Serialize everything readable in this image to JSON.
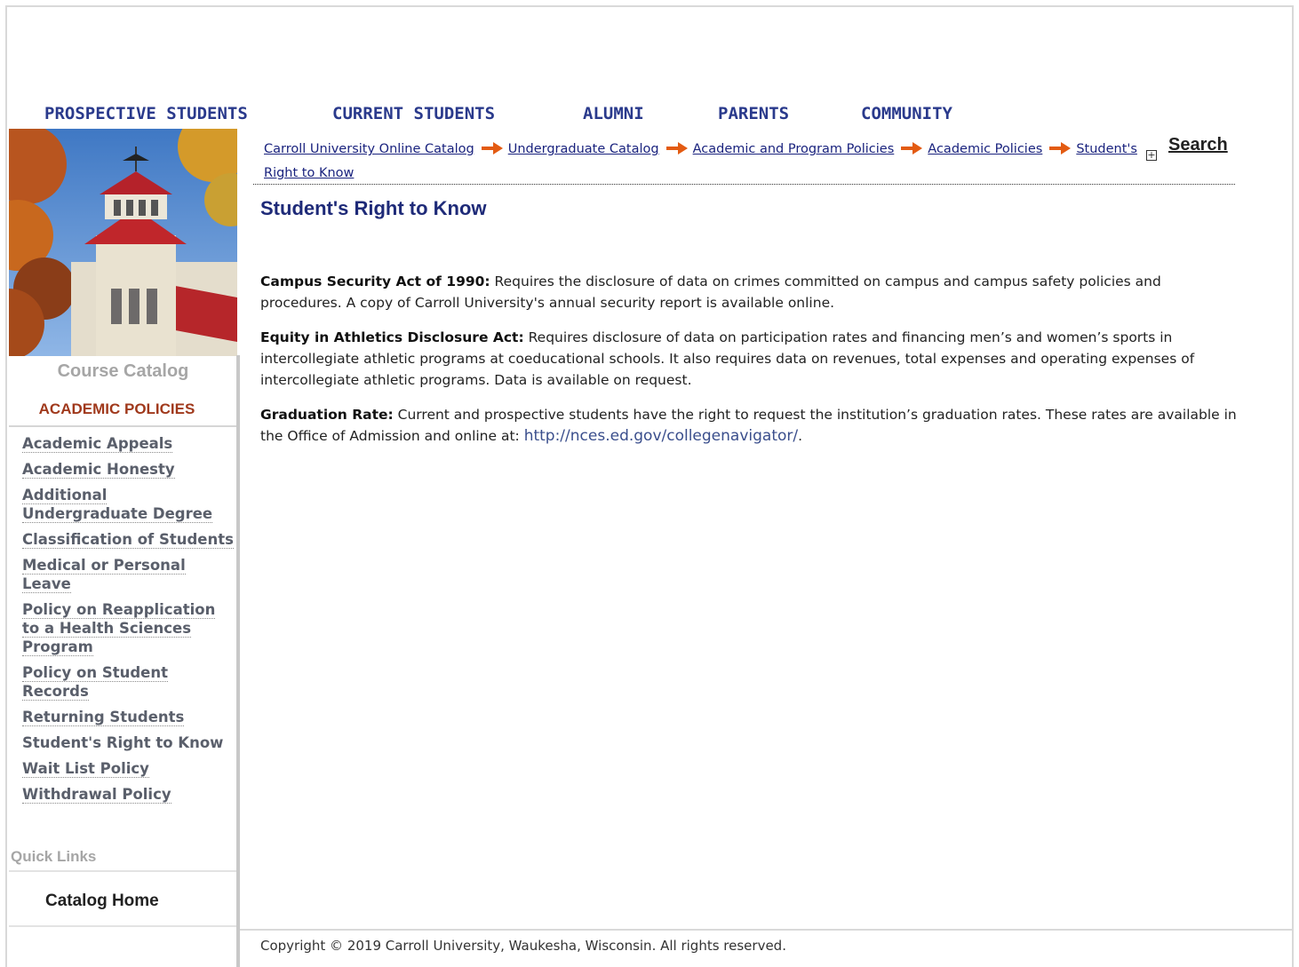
{
  "topnav": {
    "items": [
      "PROSPECTIVE STUDENTS",
      "CURRENT STUDENTS",
      "ALUMNI",
      "PARENTS",
      "COMMUNITY"
    ]
  },
  "sidebar": {
    "catalog_label": "Course Catalog",
    "heading": "ACADEMIC POLICIES",
    "links": [
      "Academic Appeals",
      "Academic Honesty",
      "Additional Undergraduate Degree",
      "Classification of Students",
      "Medical or Personal Leave",
      "Policy on Reapplication to a Health Sciences Program",
      "Policy on Student Records",
      "Returning Students",
      "Student's Right to Know",
      "Wait List Policy",
      "Withdrawal Policy"
    ],
    "quick_links_label": "Quick Links",
    "catalog_home": "Catalog Home"
  },
  "breadcrumb": [
    "Carroll University Online Catalog",
    "Undergraduate Catalog",
    "Academic and Program Policies",
    "Academic Policies",
    "Student's Right to Know"
  ],
  "search_label": "Search",
  "page_title": "Student's Right to Know",
  "paragraphs": [
    {
      "label": "Campus Security Act of 1990:",
      "text": " Requires the disclosure of data on crimes committed on campus and campus safety policies and procedures. A copy of Carroll University's annual security report is available online."
    },
    {
      "label": "Equity in Athletics Disclosure Act:",
      "text": " Requires disclosure of data on participation rates and financing men’s and women’s sports in intercollegiate athletic programs at coeducational schools. It also requires data on revenues, total expenses and operating expenses of intercollegiate athletic programs. Data is available on request."
    },
    {
      "label": "Graduation Rate:",
      "text": " Current and prospective students have the right to request the institution’s graduation rates. These rates are available in the Office of Admission and online at: ",
      "link": "http://nces.ed.gov/collegenavigator/",
      "after": "."
    }
  ],
  "footer": "Copyright © 2019 Carroll University, Waukesha, Wisconsin. All rights reserved.",
  "colors": {
    "nav": "#2a3a8c",
    "heading_accent": "#a0391c",
    "title": "#1e2a78",
    "arrow": "#e35b12"
  }
}
